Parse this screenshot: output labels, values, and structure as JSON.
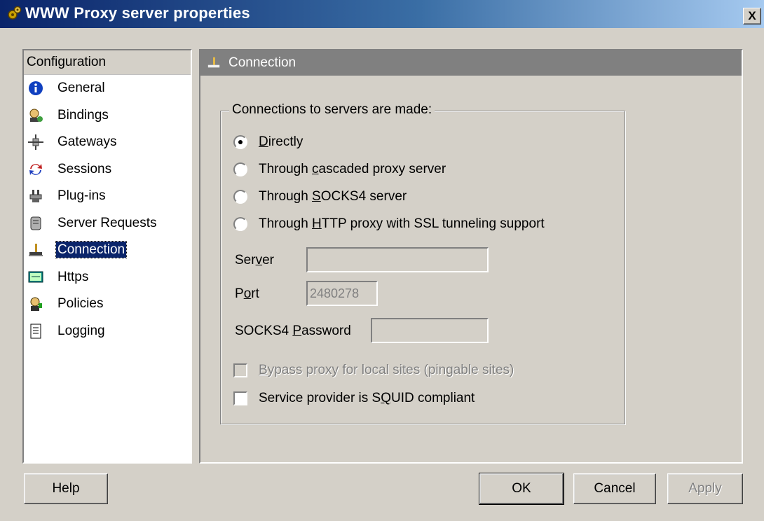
{
  "window": {
    "title": "WWW Proxy server properties",
    "close_label": "X"
  },
  "nav": {
    "header": "Configuration",
    "items": [
      {
        "label": "General",
        "icon": "info-icon"
      },
      {
        "label": "Bindings",
        "icon": "bindings-icon"
      },
      {
        "label": "Gateways",
        "icon": "gateways-icon"
      },
      {
        "label": "Sessions",
        "icon": "sessions-icon"
      },
      {
        "label": "Plug-ins",
        "icon": "plugin-icon"
      },
      {
        "label": "Server Requests",
        "icon": "server-requests-icon"
      },
      {
        "label": "Connection",
        "icon": "connection-icon",
        "selected": true
      },
      {
        "label": "Https",
        "icon": "https-icon"
      },
      {
        "label": "Policies",
        "icon": "policies-icon"
      },
      {
        "label": "Logging",
        "icon": "logging-icon"
      }
    ]
  },
  "content": {
    "header": "Connection",
    "group_title": "Connections to servers are made:",
    "radios": [
      {
        "pre": "",
        "key": "D",
        "post": "irectly",
        "checked": true
      },
      {
        "pre": "Through ",
        "key": "c",
        "post": "ascaded proxy server",
        "checked": false
      },
      {
        "pre": "Through ",
        "key": "S",
        "post": "OCKS4 server",
        "checked": false
      },
      {
        "pre": "Through ",
        "key": "H",
        "post": "TTP proxy with SSL tunneling support",
        "checked": false
      }
    ],
    "server_label": {
      "pre": "Ser",
      "key": "v",
      "post": "er"
    },
    "server_value": "",
    "port_label": {
      "pre": "P",
      "key": "o",
      "post": "rt"
    },
    "port_value": "2480278",
    "socks_label": {
      "pre": "SOCKS4 ",
      "key": "P",
      "post": "assword"
    },
    "socks_value": "",
    "bypass": {
      "pre": "",
      "key": "B",
      "post": "ypass proxy for local sites (pingable sites)",
      "checked": false,
      "disabled": true
    },
    "squid": {
      "pre": "Service provider is S",
      "key": "Q",
      "post": "UID compliant",
      "checked": false
    }
  },
  "buttons": {
    "help": "Help",
    "ok": "OK",
    "cancel": "Cancel",
    "apply": "Apply"
  }
}
